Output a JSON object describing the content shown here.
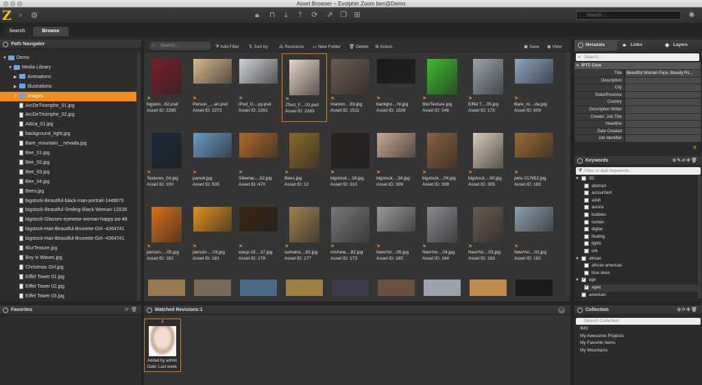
{
  "window": {
    "title": "Asset Browser – Evolphin Zoom ben@Demo"
  },
  "toolbar": {
    "logo": "Z",
    "search_placeholder": "Search..."
  },
  "tabs": [
    {
      "label": "Search"
    },
    {
      "label": "Browse"
    }
  ],
  "path_navigator": {
    "title": "Path Navigator",
    "tree": [
      {
        "label": "Demo",
        "kind": "root",
        "depth": 0,
        "expanded": true
      },
      {
        "label": "Media Library",
        "kind": "folder",
        "depth": 1,
        "expanded": true
      },
      {
        "label": "Animations",
        "kind": "folder",
        "depth": 2,
        "expanded": false
      },
      {
        "label": "Illustrations",
        "kind": "folder",
        "depth": 2,
        "expanded": false
      },
      {
        "label": "Images",
        "kind": "folder",
        "depth": 2,
        "expanded": true,
        "selected": true
      },
      {
        "label": "ArcDeTriomphe_01.jpg",
        "kind": "file",
        "depth": 3
      },
      {
        "label": "ArcDeTriomphe_02.jpg",
        "kind": "file",
        "depth": 3
      },
      {
        "label": "Attica_01.jpg",
        "kind": "file",
        "depth": 3
      },
      {
        "label": "background_right.jpg",
        "kind": "file",
        "depth": 3
      },
      {
        "label": "Bare_mountain__nevada.jpg",
        "kind": "file",
        "depth": 3
      },
      {
        "label": "Bee_01.jpg",
        "kind": "file",
        "depth": 3
      },
      {
        "label": "Bee_02.jpg",
        "kind": "file",
        "depth": 3
      },
      {
        "label": "Bee_03.jpg",
        "kind": "file",
        "depth": 3
      },
      {
        "label": "Bee_04.jpg",
        "kind": "file",
        "depth": 3
      },
      {
        "label": "Bees.jpg",
        "kind": "file",
        "depth": 3
      },
      {
        "label": "bigstock-Beautiful-black-man-portrait-1446670",
        "kind": "file",
        "depth": 3
      },
      {
        "label": "bigstock-Beautiful-Smiling-Black-Woman-12038",
        "kind": "file",
        "depth": 3
      },
      {
        "label": "bigstock-Glasses-eyewear-woman-happy-po-48",
        "kind": "file",
        "depth": 3
      },
      {
        "label": "bigstock-Hair-Beautiful-Brunette-Girl--4264741",
        "kind": "file",
        "depth": 3
      },
      {
        "label": "bigstock-Hair-Beautiful-Brunette-Girl--4264741",
        "kind": "file",
        "depth": 3
      },
      {
        "label": "BlurTexture.jpg",
        "kind": "file",
        "depth": 3
      },
      {
        "label": "Boy in Waves.jpg",
        "kind": "file",
        "depth": 3
      },
      {
        "label": "Christmas Girl.jpg",
        "kind": "file",
        "depth": 3
      },
      {
        "label": "Eiffel Tower 01.jpg",
        "kind": "file",
        "depth": 3
      },
      {
        "label": "Eiffel Tower 02.jpg",
        "kind": "file",
        "depth": 3
      },
      {
        "label": "Eiffel Tower 03.jpg",
        "kind": "file",
        "depth": 3
      }
    ]
  },
  "grid_toolbar": {
    "search_placeholder": "Search...",
    "add_filter": "Add Filter",
    "sort_by": "Sort by",
    "revisions": "Revisions",
    "new_folder": "New Folder",
    "delete": "Delete",
    "action": "Action",
    "save": "Save",
    "view": "View"
  },
  "assets": [
    {
      "name": "bigstoc...62.psd",
      "id": "Asset ID: 2265",
      "tone": "#7a1f2a"
    },
    {
      "name": "Person_....an.psd",
      "id": "Asset ID: 2272",
      "tone": "#d9b88a"
    },
    {
      "name": "iPod_D....py.psd",
      "id": "Asset ID: 2261",
      "tone": "#cfd2d6"
    },
    {
      "name": "JTest_F....02.psd",
      "id": "Asset ID: 2263",
      "tone": "#e6d3c6",
      "selected": true
    },
    {
      "name": "mannin....83.jpg",
      "id": "Asset ID: 1511",
      "tone": "#6a5a50"
    },
    {
      "name": "backgro....ht.jpg",
      "id": "Asset ID: 1509",
      "tone": "#1a1a1a"
    },
    {
      "name": "BlurTexture.jpg",
      "id": "Asset ID: 546",
      "tone": "#3dbd2e"
    },
    {
      "name": "Eiffel T....05.jpg",
      "id": "Asset ID: 175",
      "tone": "#9aa3ad"
    },
    {
      "name": "Bare_m....da.jpg",
      "id": "Asset ID: 609",
      "tone": "#8ca3c1"
    },
    {
      "name": "Textures_04.jpg",
      "id": "Asset ID: 100",
      "tone": "#1b2a3a"
    },
    {
      "name": "pano4.jpg",
      "id": "Asset ID: 535",
      "tone": "#6b9ac0"
    },
    {
      "name": "Siberiac....02.jpg",
      "id": "Asset ID: 470",
      "tone": "#b06a2a"
    },
    {
      "name": "Bees.jpg",
      "id": "Asset ID: 12",
      "tone": "#8a6a2a"
    },
    {
      "name": "bigstock....16.jpg",
      "id": "Asset ID: 310",
      "tone": "#2a2320"
    },
    {
      "name": "bigstock....34.jpg",
      "id": "Asset ID: 309",
      "tone": "#c8a890"
    },
    {
      "name": "bigstock....04.jpg",
      "id": "Asset ID: 308",
      "tone": "#8a6040"
    },
    {
      "name": "bigstock....60.jpg",
      "id": "Asset ID: 305",
      "tone": "#d8c8b8"
    },
    {
      "name": "pets-217652.jpg",
      "id": "Asset ID: 183",
      "tone": "#9a6a30"
    },
    {
      "name": "person-....05.jpg",
      "id": "Asset ID: 182",
      "tone": "#d8701a"
    },
    {
      "name": "person-....03.jpg",
      "id": "Asset ID: 181",
      "tone": "#e09020"
    },
    {
      "name": "wasp-19....37.jpg",
      "id": "Asset ID: 179",
      "tone": "#3a2410"
    },
    {
      "name": "sumatra....82.jpg",
      "id": "Asset ID: 177",
      "tone": "#a08050"
    },
    {
      "name": "michela....82.jpg",
      "id": "Asset ID: 173",
      "tone": "#777777"
    },
    {
      "name": "NewYor....05.jpg",
      "id": "Asset ID: 165",
      "tone": "#9a9a9a"
    },
    {
      "name": "NewYor....04.jpg",
      "id": "Asset ID: 164",
      "tone": "#8a8a90"
    },
    {
      "name": "NewYor....03.jpg",
      "id": "Asset ID: 163",
      "tone": "#6a5a50"
    },
    {
      "name": "NewYor....02.jpg",
      "id": "Asset ID: 162",
      "tone": "#8aa0b0"
    }
  ],
  "right_tabs": [
    {
      "label": "Metadata"
    },
    {
      "label": "Links"
    },
    {
      "label": "Layers"
    }
  ],
  "metadata": {
    "search_placeholder": "Search...",
    "section": "IPTC Core",
    "fields": [
      {
        "label": "Title",
        "value": "Beautiful Woman Face. Beauty Po..."
      },
      {
        "label": "Description",
        "value": ""
      },
      {
        "label": "City",
        "value": ""
      },
      {
        "label": "State/Province",
        "value": ""
      },
      {
        "label": "Country",
        "value": ""
      },
      {
        "label": "Description Writer",
        "value": ""
      },
      {
        "label": "Creator: Job Title",
        "value": ""
      },
      {
        "label": "Headline",
        "value": ""
      },
      {
        "label": "Date Created",
        "value": ""
      },
      {
        "label": "Job Identifier",
        "value": ""
      }
    ]
  },
  "keywords": {
    "title": "Keywords",
    "filter_placeholder": "Filter or Add Keywords...",
    "items": [
      {
        "label": "3D",
        "depth": 0,
        "group": true,
        "checked": false
      },
      {
        "label": "abstract",
        "depth": 1,
        "checked": false
      },
      {
        "label": "accountant",
        "depth": 1,
        "checked": false
      },
      {
        "label": "adult",
        "depth": 1,
        "checked": false
      },
      {
        "label": "aurora",
        "depth": 1,
        "checked": false
      },
      {
        "label": "bubbles",
        "depth": 1,
        "checked": false
      },
      {
        "label": "curtain",
        "depth": 1,
        "checked": false
      },
      {
        "label": "digital",
        "depth": 1,
        "checked": false
      },
      {
        "label": "floating",
        "depth": 1,
        "checked": false
      },
      {
        "label": "lights",
        "depth": 1,
        "checked": false
      },
      {
        "label": "orb",
        "depth": 1,
        "checked": false
      },
      {
        "label": "african",
        "depth": 0,
        "group": true,
        "checked": false
      },
      {
        "label": "african american",
        "depth": 1,
        "checked": false
      },
      {
        "label": "blue skies",
        "depth": 1,
        "checked": false
      },
      {
        "label": "age",
        "depth": 0,
        "group": true,
        "checked": true
      },
      {
        "label": "aged",
        "depth": 1,
        "checked": true
      },
      {
        "label": "american",
        "depth": 0,
        "checked": false
      }
    ]
  },
  "favorites": {
    "title": "Favorites"
  },
  "matched": {
    "title": "Matched Revisions:1",
    "revision_number": "1",
    "added_by": "Added by admin",
    "date": "Date: Last week"
  },
  "collection": {
    "title": "Collection",
    "search_placeholder": "Search Collection",
    "items": [
      "IMG",
      "My Awesome Projects",
      "My Favorite Items",
      "My Mountains"
    ]
  },
  "colors": {
    "accent": "#f08c1e",
    "logo": "#f3c318",
    "selected_border": "#d9802a"
  }
}
